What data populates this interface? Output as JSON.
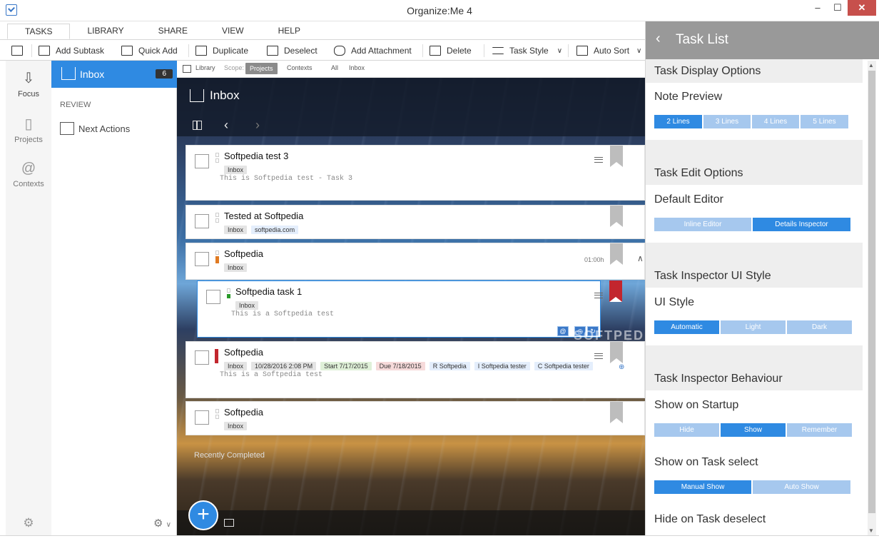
{
  "window": {
    "title": "Organize:Me 4",
    "min": "–",
    "max": "☐",
    "close": "✕"
  },
  "ribbon": {
    "tabs": [
      "TASKS",
      "LIBRARY",
      "SHARE",
      "VIEW",
      "HELP"
    ],
    "active_tab": "TASKS"
  },
  "toolbar": {
    "add_subtask": "Add Subtask",
    "quick_add": "Quick Add",
    "duplicate": "Duplicate",
    "deselect": "Deselect",
    "add_attachment": "Add Attachment",
    "delete": "Delete",
    "task_style": "Task Style",
    "auto_sort": "Auto Sort"
  },
  "rail": {
    "items": [
      {
        "label": "Focus",
        "icon": "focus-icon"
      },
      {
        "label": "Projects",
        "icon": "projects-icon"
      },
      {
        "label": "Contexts",
        "icon": "contexts-icon"
      }
    ]
  },
  "nav": {
    "inbox_label": "Inbox",
    "inbox_count": "6",
    "review_heading": "REVIEW",
    "next_actions": "Next Actions"
  },
  "scopebar": {
    "library": "Library",
    "scope": "Scope:",
    "projects": "Projects",
    "contexts": "Contexts",
    "all": "All",
    "inbox": "Inbox"
  },
  "main": {
    "title": "Inbox",
    "recently_completed": "Recently Completed",
    "fab": "+",
    "prev": "‹",
    "next": "›"
  },
  "tasks": [
    {
      "name": "Softpedia test 3",
      "tags": [
        "Inbox"
      ],
      "note": "This is Softpedia test - Task 3"
    },
    {
      "name": "Tested at Softpedia",
      "tags": [
        "Inbox",
        "softpedia.com"
      ],
      "note": ""
    },
    {
      "name": "Softpedia",
      "tags": [
        "Inbox"
      ],
      "note": "",
      "duration": "01:00h"
    },
    {
      "name": "Softpedia task 1",
      "tags": [
        "Inbox"
      ],
      "note": "This is a Softpedia test"
    },
    {
      "name": "Softpedia",
      "tags": [
        "Inbox",
        "10/28/2016 2:08 PM",
        "Start 7/17/2015",
        "Due 7/18/2015",
        "R Softpedia",
        "I Softpedia tester",
        "C Softpedia tester"
      ],
      "note": "This is a Softpedia test"
    },
    {
      "name": "Softpedia",
      "tags": [
        "Inbox"
      ],
      "note": ""
    }
  ],
  "watermark": "SOFTPEDIA",
  "right_panel": {
    "back": "‹",
    "title": "Task List",
    "display_options": "Task Display Options",
    "note_preview": "Note Preview",
    "note_preview_options": [
      "2 Lines",
      "3 Lines",
      "4 Lines",
      "5 Lines"
    ],
    "note_preview_selected": "2 Lines",
    "edit_options": "Task Edit Options",
    "default_editor": "Default Editor",
    "default_editor_options": [
      "Inline Editor",
      "Details Inspector"
    ],
    "default_editor_selected": "Details Inspector",
    "inspector_ui_style": "Task Inspector UI Style",
    "ui_style": "UI Style",
    "ui_style_options": [
      "Automatic",
      "Light",
      "Dark"
    ],
    "ui_style_selected": "Automatic",
    "inspector_behaviour": "Task Inspector Behaviour",
    "show_on_startup": "Show on Startup",
    "show_on_startup_options": [
      "Hide",
      "Show",
      "Remember"
    ],
    "show_on_startup_selected": "Show",
    "show_on_select": "Show on Task select",
    "show_on_select_options": [
      "Manual Show",
      "Auto Show"
    ],
    "show_on_select_selected": "Manual Show",
    "hide_on_deselect": "Hide on Task deselect"
  },
  "colors": {
    "accent": "#2f8ae2",
    "accent_light": "#a6c8ee",
    "priority_orange": "#e07a22",
    "priority_green": "#2a9a2a",
    "priority_red": "#c2262e"
  }
}
